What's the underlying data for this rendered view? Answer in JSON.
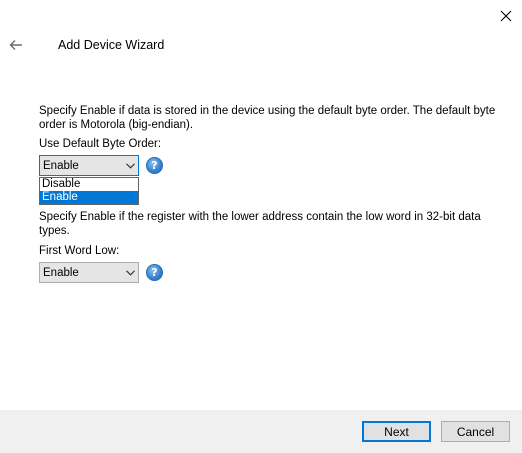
{
  "window": {
    "close_icon": "close-icon"
  },
  "header": {
    "back_icon": "arrow-left-icon",
    "title": "Add Device Wizard"
  },
  "byte_order": {
    "description": "Specify Enable if data is stored in the device using the default byte order. The default byte order is Motorola (big-endian).",
    "label": "Use Default Byte Order:",
    "value": "Enable",
    "options": [
      "Disable",
      "Enable"
    ],
    "selected_option": "Enable"
  },
  "word_order": {
    "description": "Specify Enable if the register with the lower address contain the low word in 32-bit data types.",
    "label": "First Word Low:",
    "value": "Enable"
  },
  "help": {
    "glyph": "?"
  },
  "footer": {
    "next_label": "Next",
    "cancel_label": "Cancel"
  },
  "colors": {
    "accent": "#0078d7",
    "footer_bg": "#f0f0f0",
    "button_bg": "#e1e1e1"
  }
}
